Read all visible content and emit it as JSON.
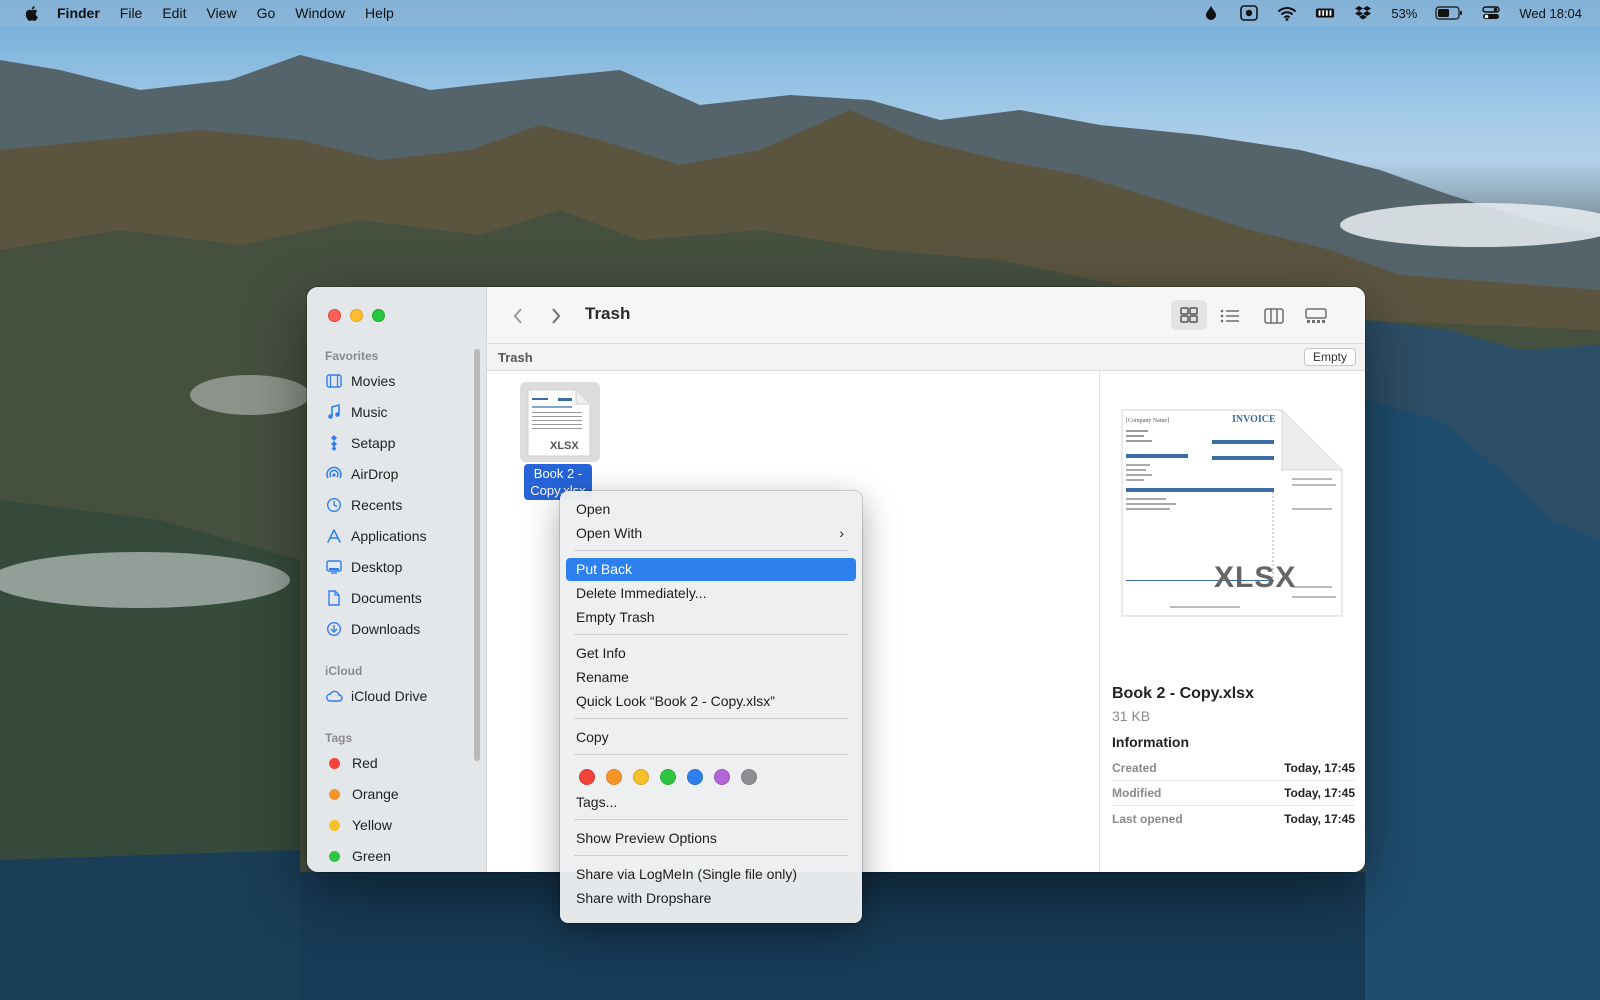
{
  "menubar": {
    "app": "Finder",
    "items": [
      "File",
      "Edit",
      "View",
      "Go",
      "Window",
      "Help"
    ],
    "battery": "53%",
    "clock": "Wed 18:04"
  },
  "window": {
    "title": "Trash",
    "path_label": "Trash",
    "empty_button": "Empty"
  },
  "sidebar": {
    "favorites_header": "Favorites",
    "favorites": [
      {
        "label": "Movies",
        "icon": "film-icon"
      },
      {
        "label": "Music",
        "icon": "music-note-icon"
      },
      {
        "label": "Setapp",
        "icon": "setapp-icon"
      },
      {
        "label": "AirDrop",
        "icon": "airdrop-icon"
      },
      {
        "label": "Recents",
        "icon": "clock-icon"
      },
      {
        "label": "Applications",
        "icon": "applications-icon"
      },
      {
        "label": "Desktop",
        "icon": "desktop-icon"
      },
      {
        "label": "Documents",
        "icon": "document-icon"
      },
      {
        "label": "Downloads",
        "icon": "download-icon"
      }
    ],
    "icloud_header": "iCloud",
    "icloud": [
      {
        "label": "iCloud Drive",
        "icon": "cloud-icon"
      }
    ],
    "tags_header": "Tags",
    "tags": [
      {
        "label": "Red",
        "color": "#f2443b"
      },
      {
        "label": "Orange",
        "color": "#f6962a"
      },
      {
        "label": "Yellow",
        "color": "#f6c02a"
      },
      {
        "label": "Green",
        "color": "#2fc543"
      }
    ]
  },
  "file": {
    "icon_badge": "XLSX",
    "label": "Book 2 - Copy.xlsx"
  },
  "preview": {
    "badge": "XLSX",
    "name": "Book 2 - Copy.xlsx",
    "size": "31 KB",
    "info_header": "Information",
    "rows": [
      {
        "key": "Created",
        "value": "Today, 17:45"
      },
      {
        "key": "Modified",
        "value": "Today, 17:45"
      },
      {
        "key": "Last opened",
        "value": "Today, 17:45"
      }
    ]
  },
  "context_menu": {
    "items": [
      "Open",
      "Open With",
      "Put Back",
      "Delete Immediately...",
      "Empty Trash",
      "Get Info",
      "Rename",
      "Quick Look “Book 2 - Copy.xlsx”",
      "Copy",
      "Tags...",
      "Show Preview Options",
      "Share via LogMeIn (Single file only)",
      "Share with Dropshare"
    ],
    "tag_colors": [
      "#f2443b",
      "#f6962a",
      "#f6c02a",
      "#2fc543",
      "#2f80ee",
      "#b266d8",
      "#8e8e93"
    ]
  }
}
